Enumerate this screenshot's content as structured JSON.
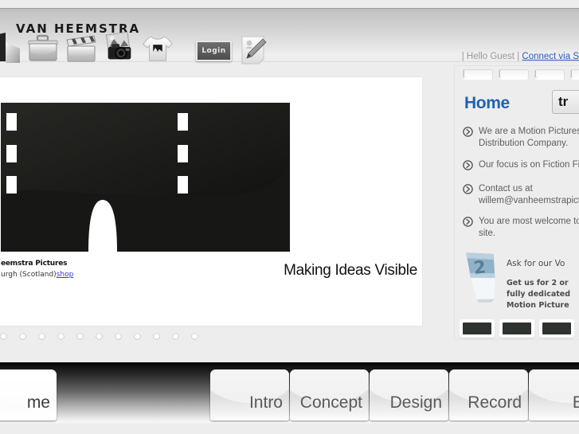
{
  "header": {
    "brand": "VAN  HEEMSTRA",
    "login_label": "Login",
    "guest_prefix": "| Hello Guest |",
    "connect_link": "Connect via S",
    "icons": [
      {
        "name": "door-icon",
        "label": "Home"
      },
      {
        "name": "briefcase-icon",
        "label": "Portfolio"
      },
      {
        "name": "clapperboard-icon",
        "label": "Films"
      },
      {
        "name": "photo-camera-icon",
        "label": "Photos"
      },
      {
        "name": "tshirt-icon",
        "label": "Shop"
      }
    ]
  },
  "main": {
    "hero_alt": "film-strip-glasses-logo",
    "company_line1": "eemstra Pictures",
    "company_line2": "urgh (Scotland)",
    "shop_link": "shop",
    "tagline": "Making Ideas Visible",
    "dot_count": 11,
    "active_dot": 0
  },
  "sidebar": {
    "tab_count": 4,
    "title": "Home",
    "translate_label": "tr",
    "bullets": [
      "We are a Motion Pictures I\nDistribution Company.",
      "Our focus is on Fiction Film",
      "Contact us at\nwillem@vanheemstrapictu",
      "You are most welcome to\nsite."
    ],
    "promo": {
      "badge": "2",
      "heading": "Ask for our Vo",
      "body": "Get us for 2 or\nfully dedicated\nMotion Picture"
    },
    "thumb_count": 4
  },
  "bottom_nav": {
    "tabs": [
      {
        "label": "me",
        "active": true
      },
      {
        "label": "",
        "spacer": true
      },
      {
        "label": "Intro",
        "active": false
      },
      {
        "label": "Concept",
        "active": false
      },
      {
        "label": "Design",
        "active": false
      },
      {
        "label": "Record",
        "active": false
      },
      {
        "label": "Edit",
        "active": false
      },
      {
        "label": "",
        "partial": true
      }
    ]
  },
  "colors": {
    "accent_blue": "#1f62b0",
    "link_blue": "#2b5bbd",
    "bg": "#ededed",
    "panel": "#ffffff"
  }
}
